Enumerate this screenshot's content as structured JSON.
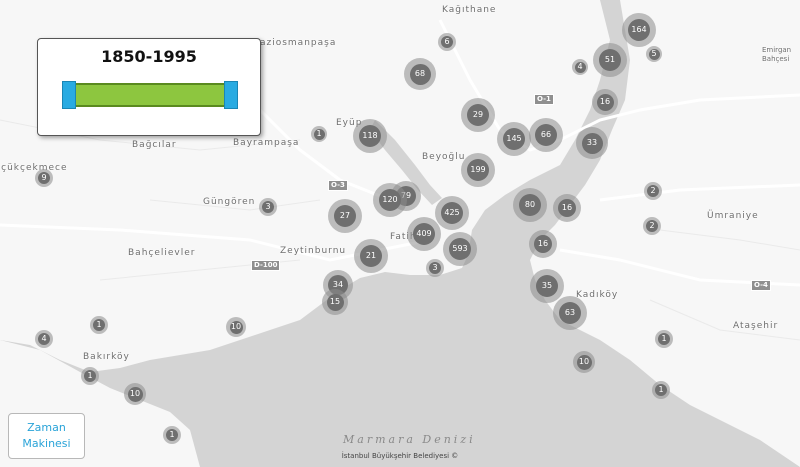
{
  "timeline": {
    "range_label": "1850-1995",
    "range_start_fraction": 0.0,
    "range_end_fraction": 1.0
  },
  "time_machine_button": {
    "line1": "Zaman",
    "line2": "Makinesi"
  },
  "attribution": "İstanbul Büyükşehir Belediyesi ©",
  "sea_label": "Marmara Denizi",
  "places": [
    {
      "id": "kagithane",
      "label": "Kağıthane"
    },
    {
      "id": "gaziosmanpasa",
      "label": "Gaziosmanpaşa"
    },
    {
      "id": "eyup",
      "label": "Eyüp"
    },
    {
      "id": "bagcilar",
      "label": "Bağcılar"
    },
    {
      "id": "bayrampasa",
      "label": "Bayrampaşa"
    },
    {
      "id": "beyoglu",
      "label": "Beyoğlu"
    },
    {
      "id": "kucukcekmece",
      "label": "Küçükçekmece"
    },
    {
      "id": "gungoren",
      "label": "Güngören"
    },
    {
      "id": "bahcelievler",
      "label": "Bahçelievler"
    },
    {
      "id": "zeytinburnu",
      "label": "Zeytinburnu"
    },
    {
      "id": "fatih",
      "label": "Fatih"
    },
    {
      "id": "bakirkoy",
      "label": "Bakırköy"
    },
    {
      "id": "kadikoy",
      "label": "Kadıköy"
    },
    {
      "id": "umraniye",
      "label": "Ümraniye"
    },
    {
      "id": "atasehir",
      "label": "Ataşehir"
    },
    {
      "id": "emirgan",
      "label": "Emirgan Bahçesi"
    }
  ],
  "road_shields": [
    "O-1",
    "O-3",
    "D-100",
    "O-4"
  ],
  "clusters": [
    {
      "count": "164"
    },
    {
      "count": "5"
    },
    {
      "count": "51"
    },
    {
      "count": "4"
    },
    {
      "count": "6"
    },
    {
      "count": "68"
    },
    {
      "count": "16"
    },
    {
      "count": "1"
    },
    {
      "count": "118"
    },
    {
      "count": "29"
    },
    {
      "count": "145"
    },
    {
      "count": "66"
    },
    {
      "count": "33"
    },
    {
      "count": "9"
    },
    {
      "count": "199"
    },
    {
      "count": "79"
    },
    {
      "count": "120"
    },
    {
      "count": "3"
    },
    {
      "count": "27"
    },
    {
      "count": "425"
    },
    {
      "count": "80"
    },
    {
      "count": "16"
    },
    {
      "count": "2"
    },
    {
      "count": "2"
    },
    {
      "count": "409"
    },
    {
      "count": "593"
    },
    {
      "count": "16"
    },
    {
      "count": "21"
    },
    {
      "count": "3"
    },
    {
      "count": "34"
    },
    {
      "count": "15"
    },
    {
      "count": "35"
    },
    {
      "count": "63"
    },
    {
      "count": "1"
    },
    {
      "count": "10"
    },
    {
      "count": "4"
    },
    {
      "count": "1"
    },
    {
      "count": "10"
    },
    {
      "count": "1"
    },
    {
      "count": "10"
    },
    {
      "count": "1"
    },
    {
      "count": "1"
    }
  ],
  "colors": {
    "land": "#f7f7f7",
    "water": "#cfcfcf",
    "cluster_fill": "#6f6f6f",
    "range_fill": "#8dc63f",
    "handle": "#29abe2",
    "button_text": "#29a3d8"
  }
}
